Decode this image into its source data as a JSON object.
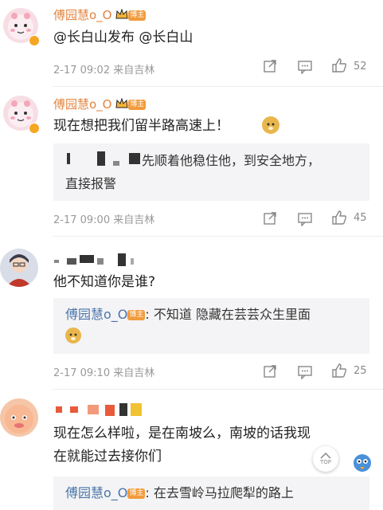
{
  "comments": [
    {
      "author": "傅园慧o_O",
      "author_badge": "博主",
      "text": "@长白山发布 @长白山",
      "time": "2-17 09:02",
      "location": "来自吉林",
      "likes": "52"
    },
    {
      "author": "傅园慧o_O",
      "author_badge": "博主",
      "text": "现在想把我们留半路高速上！",
      "reply_text_line1": "先顺着他稳住他，到安全地方，",
      "reply_text_line2": "直接报警",
      "time": "2-17 09:00",
      "location": "来自吉林",
      "likes": "45"
    },
    {
      "text": "他不知道你是谁?",
      "reply_author": "傅园慧o_O",
      "reply_badge": "博主",
      "reply_text": ": 不知道 隐藏在芸芸众生里面",
      "time": "2-17 09:10",
      "location": "来自吉林",
      "likes": "25"
    },
    {
      "text_line1": "现在怎么样啦，是在南坡么，南坡的话我现",
      "text_line2": "在就能过去接你们",
      "reply_author": "傅园慧o_O",
      "reply_badge": "博主",
      "reply_text": ": 在去雪岭马拉爬犁的路上"
    }
  ],
  "top_button_label": "TOP",
  "colors": {
    "author": "#e3843f",
    "link": "#4a74a8",
    "badge": "#f19b3c"
  }
}
